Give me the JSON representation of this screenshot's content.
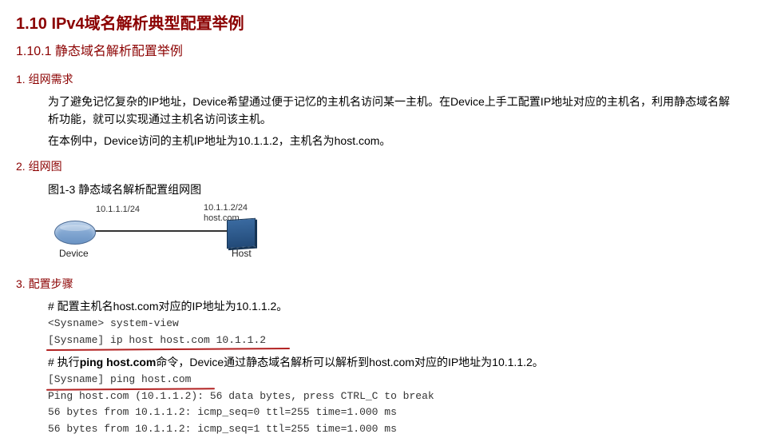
{
  "headings": {
    "h1": "1.10  IPv4域名解析典型配置举例",
    "h2": "1.10.1  静态域名解析配置举例",
    "sec1": "1. 组网需求",
    "sec2": "2. 组网图",
    "sec3": "3. 配置步骤"
  },
  "req": {
    "p1": "为了避免记忆复杂的IP地址，Device希望通过便于记忆的主机名访问某一主机。在Device上手工配置IP地址对应的主机名，利用静态域名解析功能，就可以实现通过主机名访问该主机。",
    "p2": "在本例中，Device访问的主机IP地址为10.1.1.2，主机名为host.com。"
  },
  "fig": {
    "caption": "图1-3 静态域名解析配置组网图",
    "iface_left": "10.1.1.1/24",
    "iface_right_ip": "10.1.1.2/24",
    "iface_right_name": "host.com",
    "dev_left": "Device",
    "dev_right": "Host"
  },
  "steps": {
    "s1": "# 配置主机名host.com对应的IP地址为10.1.1.2。",
    "c1": "<Sysname> system-view",
    "c2": "[Sysname] ip host host.com 10.1.1.2",
    "s2a": "# 执行",
    "s2b": "ping host.com",
    "s2c": "命令，Device通过静态域名解析可以解析到host.com对应的IP地址为10.1.1.2。",
    "c3": "[Sysname] ping host.com",
    "c4": "Ping host.com (10.1.1.2): 56 data bytes, press CTRL_C to break",
    "c5": "56 bytes from 10.1.1.2: icmp_seq=0 ttl=255 time=1.000 ms",
    "c6": "56 bytes from 10.1.1.2: icmp_seq=1 ttl=255 time=1.000 ms"
  }
}
